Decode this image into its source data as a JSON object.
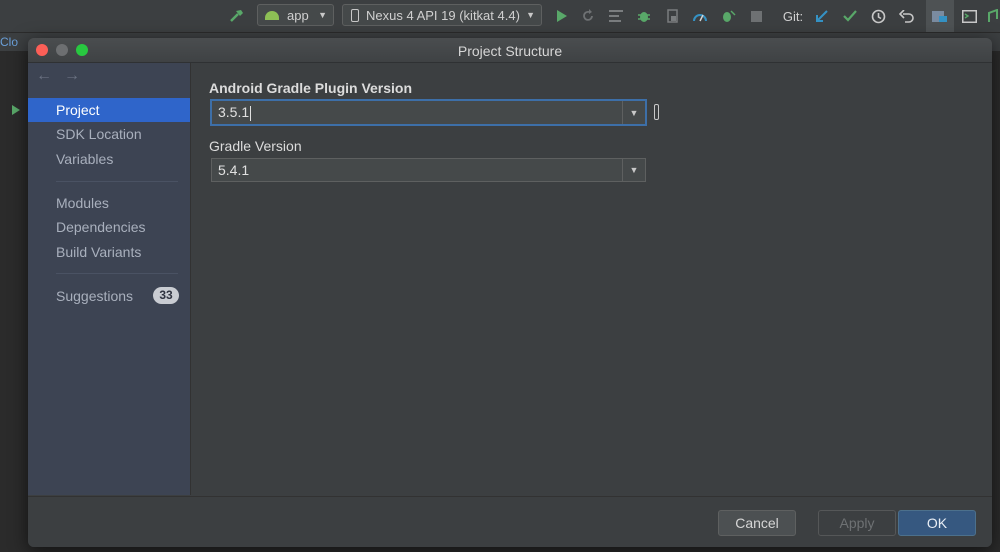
{
  "toolbar": {
    "run_config": "app",
    "device": "Nexus 4 API 19 (kitkat 4.4)",
    "git_label": "Git:",
    "icons": [
      "hammer-icon",
      "android-icon",
      "phone-icon",
      "run-icon",
      "rerun-icon",
      "logcat-icon",
      "debug-icon",
      "coverage-icon",
      "profile-icon",
      "attach-debugger-icon",
      "stop-icon",
      "git-update-icon",
      "git-commit-icon",
      "git-history-icon",
      "git-revert-icon",
      "project-structure-icon",
      "terminal-icon"
    ]
  },
  "ide": {
    "tab_fragment": "Clo"
  },
  "colors": {
    "accent": "#2f65ca",
    "ok_button": "#365880",
    "sidebar": "#3d4453",
    "green_icon": "#59a869",
    "blue_icon": "#3592c4"
  },
  "dialog": {
    "title": "Project Structure",
    "sidebar": {
      "groups": [
        [
          "Project",
          "SDK Location",
          "Variables"
        ],
        [
          "Modules",
          "Dependencies",
          "Build Variants"
        ]
      ],
      "items": {
        "project": "Project",
        "sdk_location": "SDK Location",
        "variables": "Variables",
        "modules": "Modules",
        "dependencies": "Dependencies",
        "build_variants": "Build Variants",
        "suggestions": "Suggestions"
      },
      "selected": "Project",
      "suggestions_count": "33"
    },
    "content": {
      "agp_label": "Android Gradle Plugin Version",
      "agp_value": "3.5.1",
      "gradle_label": "Gradle Version",
      "gradle_value": "5.4.1"
    },
    "buttons": {
      "cancel": "Cancel",
      "apply": "Apply",
      "ok": "OK"
    }
  }
}
